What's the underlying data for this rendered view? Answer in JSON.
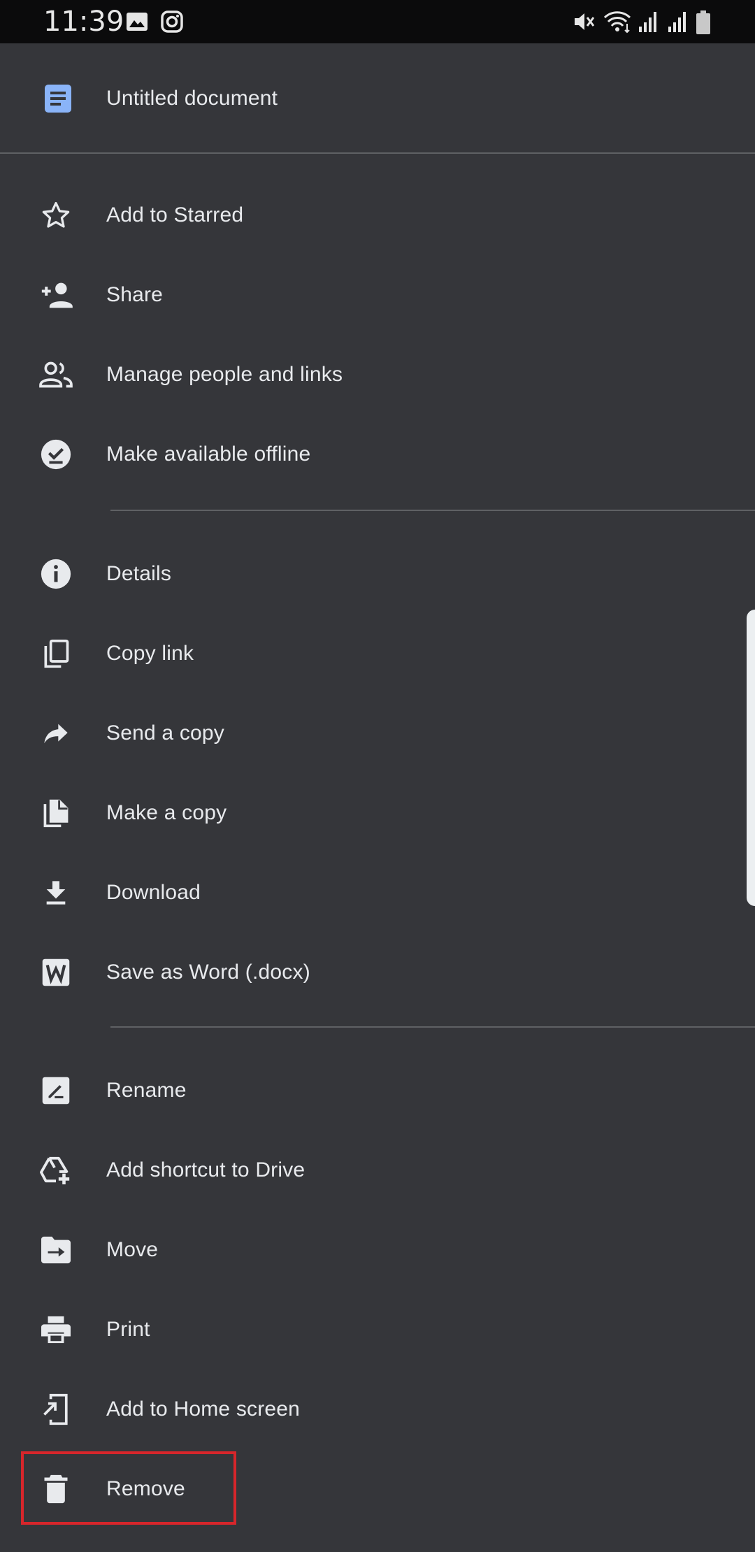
{
  "status_bar": {
    "time": "11:39",
    "left_icons": [
      "gallery-icon",
      "instagram-icon"
    ],
    "right_icons": [
      "mute-icon",
      "wifi-icon",
      "signal-icon",
      "signal-icon",
      "battery-icon"
    ]
  },
  "header": {
    "doc_icon": "docs-icon",
    "title": "Untitled document",
    "accent_color": "#8ab4f8"
  },
  "menu": {
    "items": [
      {
        "id": "star",
        "icon": "star-outline-icon",
        "label": "Add to Starred"
      },
      {
        "id": "share",
        "icon": "person-add-icon",
        "label": "Share"
      },
      {
        "id": "manage",
        "icon": "people-icon",
        "label": "Manage people and links"
      },
      {
        "id": "offline",
        "icon": "offline-check-icon",
        "label": "Make available offline"
      },
      {
        "id": "details",
        "icon": "info-icon",
        "label": "Details"
      },
      {
        "id": "copylink",
        "icon": "copy-icon",
        "label": "Copy link"
      },
      {
        "id": "send",
        "icon": "forward-arrow-icon",
        "label": "Send a copy"
      },
      {
        "id": "makecopy",
        "icon": "file-copy-icon",
        "label": "Make a copy"
      },
      {
        "id": "download",
        "icon": "download-icon",
        "label": "Download"
      },
      {
        "id": "word",
        "icon": "word-icon",
        "label": "Save as Word (.docx)"
      },
      {
        "id": "rename",
        "icon": "rename-icon",
        "label": "Rename"
      },
      {
        "id": "shortcut",
        "icon": "drive-shortcut-icon",
        "label": "Add shortcut to Drive"
      },
      {
        "id": "move",
        "icon": "move-folder-icon",
        "label": "Move"
      },
      {
        "id": "print",
        "icon": "print-icon",
        "label": "Print"
      },
      {
        "id": "homescreen",
        "icon": "add-to-home-icon",
        "label": "Add to Home screen"
      },
      {
        "id": "remove",
        "icon": "trash-icon",
        "label": "Remove"
      }
    ],
    "highlight_color": "#d7262b"
  }
}
